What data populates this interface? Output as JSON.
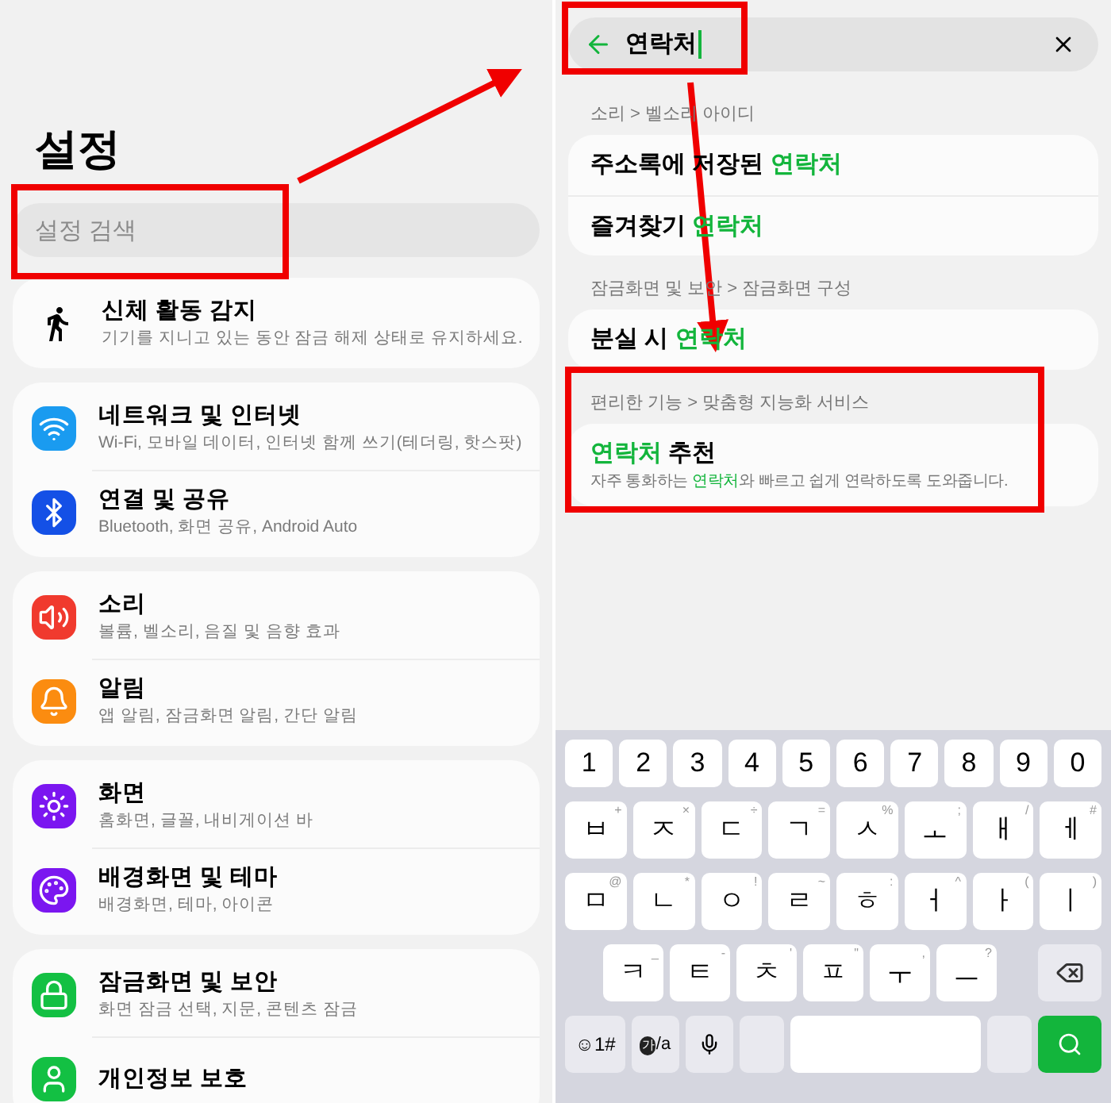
{
  "settings": {
    "title": "설정",
    "search": {
      "placeholder": "설정 검색"
    },
    "groups": [
      {
        "items": [
          {
            "title": "신체 활동 감지",
            "subtitle": "기기를 지니고 있는 동안 잠금 해제 상태로 유지하세요."
          }
        ]
      },
      {
        "items": [
          {
            "title": "네트워크 및 인터넷",
            "subtitle": "Wi-Fi, 모바일 데이터, 인터넷 함께 쓰기(테더링, 핫스팟)",
            "color": "#1a9bf0"
          },
          {
            "title": "연결 및 공유",
            "subtitle": "Bluetooth, 화면 공유, Android Auto",
            "color": "#1450e6"
          }
        ]
      },
      {
        "items": [
          {
            "title": "소리",
            "subtitle": "볼륨, 벨소리, 음질 및 음향 효과",
            "color": "#f03a2e"
          },
          {
            "title": "알림",
            "subtitle": "앱 알림, 잠금화면 알림, 간단 알림",
            "color": "#fb8c10"
          }
        ]
      },
      {
        "items": [
          {
            "title": "화면",
            "subtitle": "홈화면, 글꼴, 내비게이션 바",
            "color": "#7b16f0"
          },
          {
            "title": "배경화면 및 테마",
            "subtitle": "배경화면, 테마, 아이콘",
            "color": "#7b16f0"
          }
        ]
      },
      {
        "items": [
          {
            "title": "잠금화면 및 보안",
            "subtitle": "화면 잠금 선택, 지문, 콘텐츠 잠금",
            "color": "#13c043"
          },
          {
            "title": "개인정보 보호",
            "color": "#13c043"
          }
        ]
      }
    ]
  },
  "search_results": {
    "query": "연락처",
    "sections": [
      {
        "path": "소리 > 벨소리 아이디",
        "items": [
          {
            "title": [
              {
                "text": "주소록에 저장된 ",
                "match": false
              },
              {
                "text": "연락처",
                "match": true
              }
            ]
          },
          {
            "title": [
              {
                "text": "즐겨찾기 ",
                "match": false
              },
              {
                "text": "연락처",
                "match": true
              }
            ]
          }
        ]
      },
      {
        "path": "잠금화면 및 보안 > 잠금화면 구성",
        "items": [
          {
            "title": [
              {
                "text": "분실 시 ",
                "match": false
              },
              {
                "text": "연락처",
                "match": true
              }
            ]
          }
        ]
      },
      {
        "path": "편리한 기능 > 맞춤형 지능화 서비스",
        "items": [
          {
            "title": [
              {
                "text": "연락처",
                "match": true
              },
              {
                "text": " 추천",
                "match": false
              }
            ],
            "subtitle": [
              {
                "text": "자주 통화하는 ",
                "match": false
              },
              {
                "text": "연락처",
                "match": true
              },
              {
                "text": "와 빠르고 쉽게 연락하도록 도와줍니다.",
                "match": false
              }
            ]
          }
        ]
      }
    ]
  },
  "keyboard": {
    "numbers": [
      "1",
      "2",
      "3",
      "4",
      "5",
      "6",
      "7",
      "8",
      "9",
      "0"
    ],
    "rows": [
      [
        {
          "label": "ㅂ",
          "hint": "+"
        },
        {
          "label": "ㅈ",
          "hint": "×"
        },
        {
          "label": "ㄷ",
          "hint": "÷"
        },
        {
          "label": "ㄱ",
          "hint": "="
        },
        {
          "label": "ㅅ",
          "hint": "%"
        },
        {
          "label": "ㅗ",
          "hint": ";"
        },
        {
          "label": "ㅐ",
          "hint": "/"
        },
        {
          "label": "ㅔ",
          "hint": "#"
        }
      ],
      [
        {
          "label": "ㅁ",
          "hint": "@"
        },
        {
          "label": "ㄴ",
          "hint": "*"
        },
        {
          "label": "ㅇ",
          "hint": "!"
        },
        {
          "label": "ㄹ",
          "hint": "~"
        },
        {
          "label": "ㅎ",
          "hint": ":"
        },
        {
          "label": "ㅓ",
          "hint": "^"
        },
        {
          "label": "ㅏ",
          "hint": "("
        },
        {
          "label": "ㅣ",
          "hint": ")"
        }
      ],
      [
        {
          "label": "ㅋ",
          "hint": "_"
        },
        {
          "label": "ㅌ",
          "hint": "-"
        },
        {
          "label": "ㅊ",
          "hint": "'"
        },
        {
          "label": "ㅍ",
          "hint": "\""
        },
        {
          "label": "ㅜ",
          "hint": ","
        },
        {
          "label": "ㅡ",
          "hint": "?"
        }
      ]
    ],
    "bottom": [
      {
        "kind": "symbols",
        "label": "☺1#"
      },
      {
        "kind": "language",
        "main": "가",
        "sub": "/a"
      },
      {
        "kind": "mic"
      },
      {
        "kind": "more"
      },
      {
        "kind": "space"
      },
      {
        "kind": "more"
      },
      {
        "kind": "search"
      }
    ]
  }
}
